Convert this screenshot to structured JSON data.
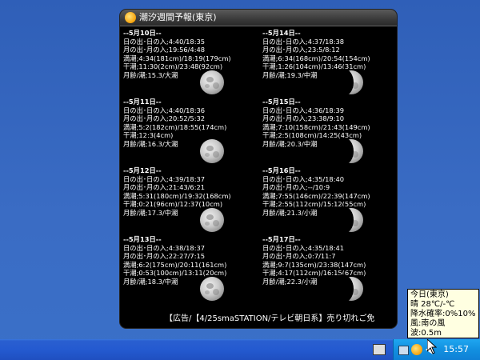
{
  "widget": {
    "title": "潮汐週間予報(東京)",
    "ticker": "【広告/【4/25smaSTATION/テレビ朝日系】売り切れご免"
  },
  "days": [
    {
      "date": "--5月10日--",
      "sun": "日の出･日の入;4:40/18:35",
      "moon": "月の出･月の入;19:56/4:48",
      "high": "満潮;4:34(181cm)/18:19(179cm)",
      "low": "干潮;11:30(2cm)/23:48(92cm)",
      "age": "月齢/潮;15.3/大潮",
      "phase": "full"
    },
    {
      "date": "--5月11日--",
      "sun": "日の出･日の入;4:40/18:36",
      "moon": "月の出･月の入;20:52/5:32",
      "high": "満潮;5:2(182cm)/18:55(174cm)",
      "low": "干潮;12:3(4cm)",
      "age": "月齢/潮;16.3/大潮",
      "phase": "full"
    },
    {
      "date": "--5月12日--",
      "sun": "日の出･日の入;4:39/18:37",
      "moon": "月の出･月の入;21:43/6:21",
      "high": "満潮;5:31(180cm)/19:32(168cm)",
      "low": "干潮;0:21(96cm)/12:37(10cm)",
      "age": "月齢/潮;17.3/中潮",
      "phase": "full"
    },
    {
      "date": "--5月13日--",
      "sun": "日の出･日の入;4:38/18:37",
      "moon": "月の出･月の入;22:27/7:15",
      "high": "満潮;6:2(175cm)/20:11(161cm)",
      "low": "干潮;0:53(100cm)/13:11(20cm)",
      "age": "月齢/潮;18.3/中潮",
      "phase": "full"
    },
    {
      "date": "--5月14日--",
      "sun": "日の出･日の入;4:37/18:38",
      "moon": "月の出･月の入;23:5/8:12",
      "high": "満潮;6:34(168cm)/20:54(154cm)",
      "low": "干潮;1:26(104cm)/13:46(31cm)",
      "age": "月齢/潮;19.3/中潮",
      "phase": "waning"
    },
    {
      "date": "--5月15日--",
      "sun": "日の出･日の入;4:36/18:39",
      "moon": "月の出･月の入;23:38/9:10",
      "high": "満潮;7:10(158cm)/21:43(149cm)",
      "low": "干潮;2:5(108cm)/14:25(43cm)",
      "age": "月齢/潮;20.3/中潮",
      "phase": "waning"
    },
    {
      "date": "--5月16日--",
      "sun": "日の出･日の入;4:35/18:40",
      "moon": "月の出･月の入;--/10:9",
      "high": "満潮;7:55(146cm)/22:39(147cm)",
      "low": "干潮;2:55(112cm)/15:12(55cm)",
      "age": "月齢/潮;21.3/小潮",
      "phase": "waning"
    },
    {
      "date": "--5月17日--",
      "sun": "日の出･日の入;4:35/18:41",
      "moon": "月の出･月の入;0:7/11:7",
      "high": "満潮;9:7(135cm)/23:38(147cm)",
      "low": "干潮;4:17(112cm)/16:15(67cm)",
      "age": "月齢/潮;22.3/小潮",
      "phase": "waning-strong"
    }
  ],
  "tooltip": {
    "lines": [
      "今日(東京)",
      "晴 28℃/-℃",
      "降水確率:0%10%",
      "風:南の風",
      "波:0.5m"
    ]
  },
  "taskbar": {
    "clock": "15:57"
  },
  "icons": {
    "widget": "sun-icon",
    "tray": [
      "network-icon",
      "weather-sun-icon",
      "volume-icon"
    ],
    "keyboard": "keyboard-icon"
  }
}
